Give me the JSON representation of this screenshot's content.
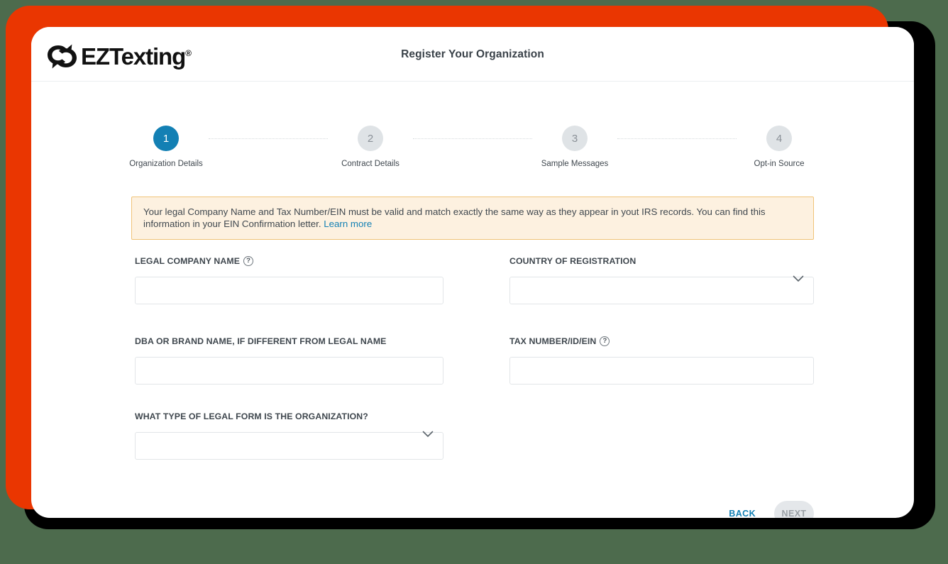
{
  "window": {
    "background_color": "#4d6b4d",
    "accent_frame_color": "#ea3601"
  },
  "header": {
    "logo_text": "EZTexting",
    "logo_registered_mark": "®",
    "logo_icon": "ez-texting-speech-bubbles-logo",
    "title": "Register Your Organization"
  },
  "stepper": {
    "active_color": "#1380b4",
    "inactive_color": "#dfe3e6",
    "steps": [
      {
        "number": "1",
        "label": "Organization Details",
        "active": true
      },
      {
        "number": "2",
        "label": "Contract Details",
        "active": false
      },
      {
        "number": "3",
        "label": "Sample Messages",
        "active": false
      },
      {
        "number": "4",
        "label": "Opt-in Source",
        "active": false
      }
    ]
  },
  "alert": {
    "text": "Your legal Company Name and Tax Number/EIN must be valid and match exactly the same way as they appear in yout IRS records. You can find this information in your EIN Confirmation letter. ",
    "link_label": "Learn more",
    "background_color": "#fdf1e0",
    "border_color": "#f0c378",
    "link_color": "#1380b4"
  },
  "form": {
    "legal_company_name": {
      "label": "LEGAL COMPANY NAME",
      "help": "?",
      "value": "",
      "placeholder": ""
    },
    "country_of_registration": {
      "label": "COUNTRY OF REGISTRATION",
      "value": "",
      "chevron": "chevron-down-icon"
    },
    "dba_brand_name": {
      "label": "DBA OR BRAND NAME, IF DIFFERENT FROM LEGAL NAME",
      "value": "",
      "placeholder": ""
    },
    "tax_number": {
      "label": "TAX NUMBER/ID/EIN",
      "help": "?",
      "value": "",
      "placeholder": ""
    },
    "legal_form": {
      "label": "WHAT TYPE OF LEGAL FORM IS THE ORGANIZATION?",
      "value": "",
      "chevron": "chevron-down-icon"
    }
  },
  "actions": {
    "back_label": "BACK",
    "next_label": "NEXT",
    "next_disabled": true
  }
}
